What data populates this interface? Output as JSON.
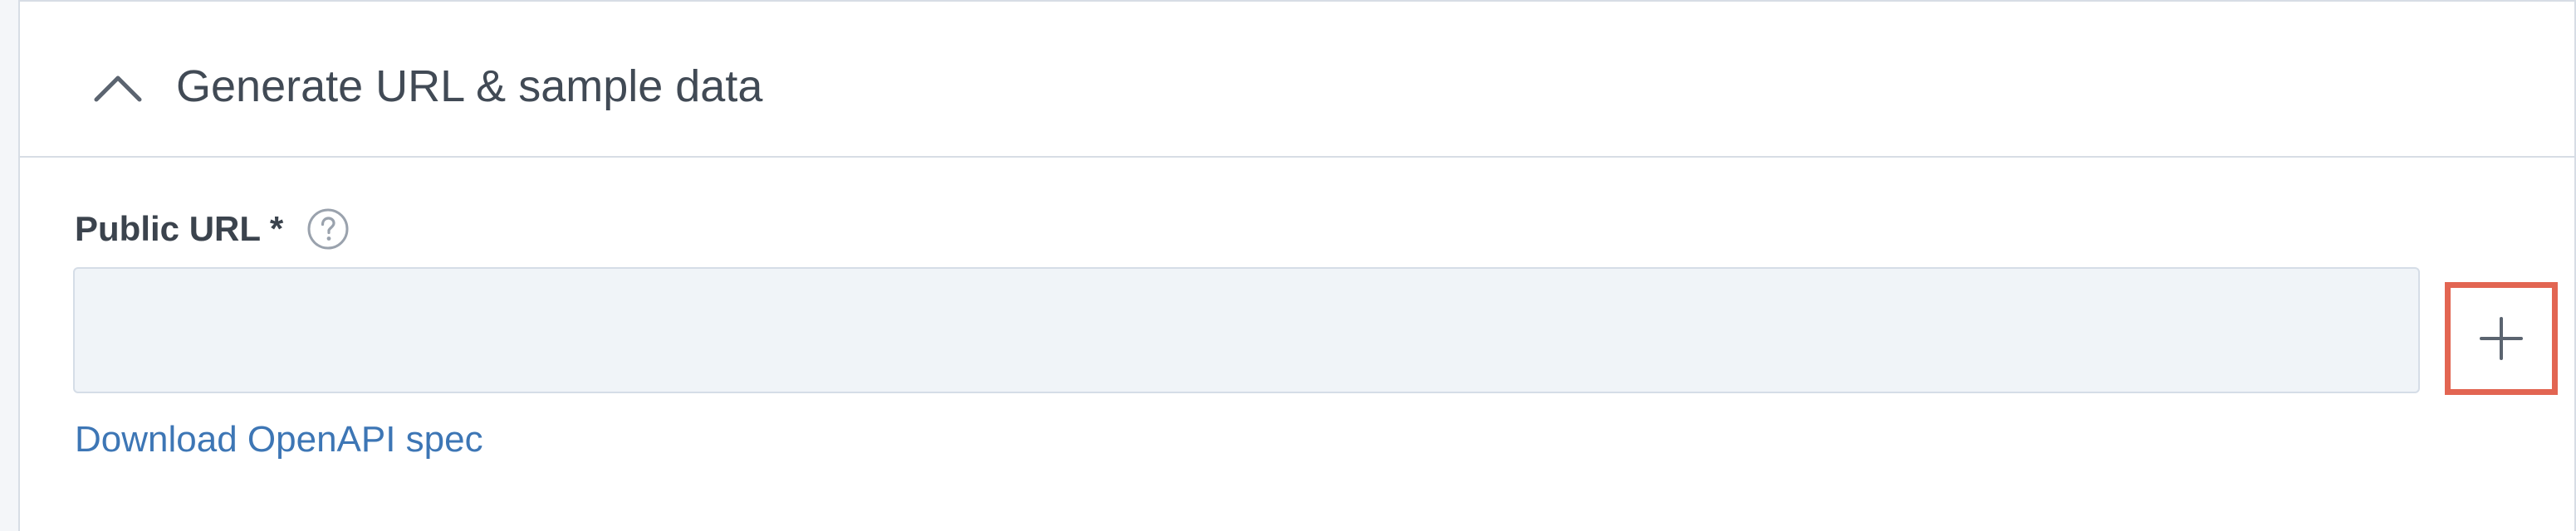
{
  "section": {
    "title": "Generate URL & sample data",
    "toggle_icon": "chevron-up-icon"
  },
  "field": {
    "label": "Public URL *",
    "help_icon": "help-circle-icon",
    "value": "",
    "add_icon": "plus-icon"
  },
  "link": {
    "download_label": "Download OpenAPI spec"
  },
  "colors": {
    "title_text": "#414a55",
    "label_text": "#3b434d",
    "link": "#3d76b5",
    "input_background": "#f0f4f8",
    "highlight_border": "#e26552",
    "divider": "#d7dde5"
  }
}
